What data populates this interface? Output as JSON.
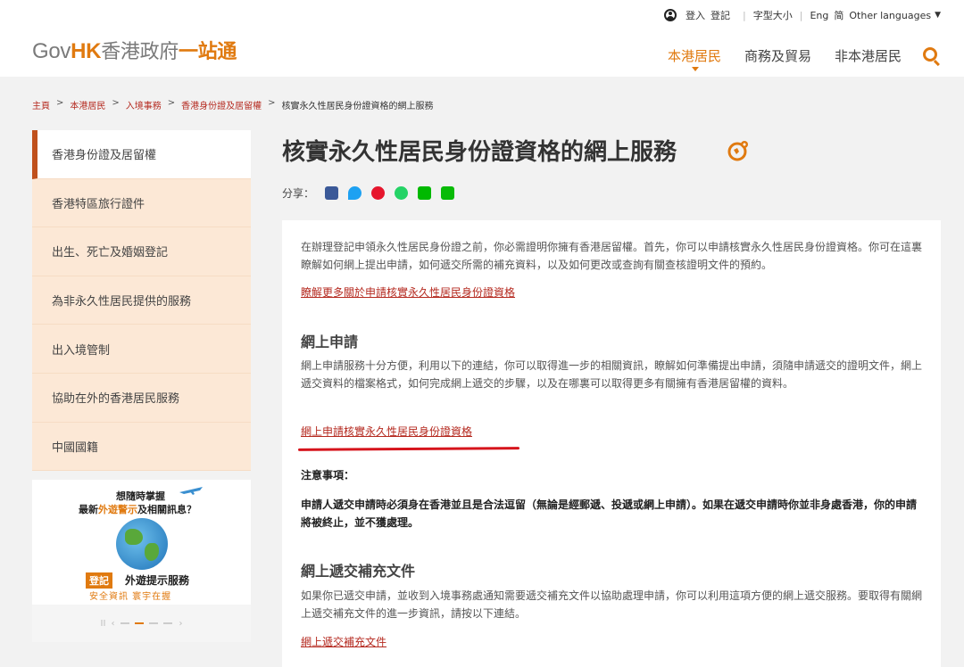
{
  "header": {
    "logo": {
      "gov": "Gov",
      "hk": "HK",
      "cn": "香港政府",
      "cn2": "一站通"
    },
    "util": {
      "login": "登入",
      "register": "登記",
      "font_size": "字型大小",
      "lang_en": "Eng",
      "lang_sc": "简",
      "other_languages": "Other languages"
    },
    "nav": [
      {
        "label": "本港居民",
        "active": true
      },
      {
        "label": "商務及貿易",
        "active": false
      },
      {
        "label": "非本港居民",
        "active": false
      }
    ]
  },
  "breadcrumb": [
    "主頁",
    "本港居民",
    "入境事務",
    "香港身份證及居留權",
    "核實永久性居民身份證資格的網上服務"
  ],
  "sidebar": {
    "items": [
      {
        "label": "香港身份證及居留權"
      },
      {
        "label": "香港特區旅行證件"
      },
      {
        "label": "出生、死亡及婚姻登記"
      },
      {
        "label": "為非永久性居民提供的服務"
      },
      {
        "label": "出入境管制"
      },
      {
        "label": "協助在外的香港居民服務"
      },
      {
        "label": "中國國籍"
      }
    ],
    "promo": {
      "line1": "想隨時掌握",
      "line2_a": "最新",
      "line2_hl": "外遊警示",
      "line2_b": "及相關訊息？",
      "reg_badge": "登記",
      "reg_text": "外遊提示服務",
      "reg_sub": "安全資訊  寰宇在握"
    }
  },
  "content": {
    "title": "核實永久性居民身份證資格的網上服務",
    "share_label": "分享：",
    "intro": "在辦理登記申領永久性居民身份證之前，你必需證明你擁有香港居留權。首先，你可以申請核實永久性居民身份證資格。你可在這裏瞭解如何網上提出申請，如何遞交所需的補充資料，以及如何更改或查詢有關查核證明文件的預約。",
    "intro_link": "瞭解更多關於申請核實永久性居民身份證資格",
    "online_heading": "網上申請",
    "online_text": "網上申請服務十分方便，利用以下的連結，你可以取得進一步的相關資訊，瞭解如何準備提出申請，須隨申請遞交的證明文件，網上遞交資料的檔案格式，如何完成網上遞交的步驟，以及在哪裏可以取得更多有關擁有香港居留權的資料。",
    "online_link": "網上申請核實永久性居民身份證資格",
    "notice_heading": "注意事項：",
    "notice_text": "申請人遞交申請時必須身在香港並且是合法逗留（無論是經郵遞、投遞或網上申請）。如果在遞交申請時你並非身處香港，你的申請將被終止，並不獲處理。",
    "supp_heading": "網上遞交補充文件",
    "supp_text": "如果你已遞交申請，並收到入境事務處通知需要遞交補充文件以協助處理申請，你可以利用這項方便的網上遞交服務。要取得有關網上遞交補充文件的進一步資訊，請按以下連結。",
    "supp_link": "網上遞交補充文件"
  }
}
